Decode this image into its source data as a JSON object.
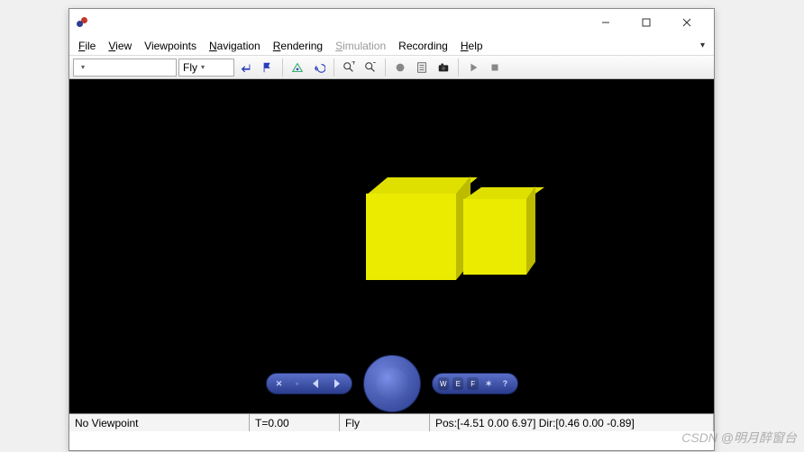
{
  "titlebar": {},
  "menu": {
    "file": "File",
    "view": "View",
    "viewpoints": "Viewpoints",
    "navigation": "Navigation",
    "rendering": "Rendering",
    "simulation": "Simulation",
    "recording": "Recording",
    "help": "Help"
  },
  "toolbar": {
    "nav_mode_options": [
      "Fly"
    ],
    "nav_mode_selected": "Fly"
  },
  "navpad": {
    "btn_w": "W",
    "btn_e": "E",
    "btn_f": "F",
    "btn_q": "?"
  },
  "status": {
    "viewpoint": "No Viewpoint",
    "time": "T=0.00",
    "mode": "Fly",
    "pos": "Pos:[-4.51 0.00 6.97] Dir:[0.46 0.00 -0.89]"
  },
  "watermark": "CSDN @明月醉窗台",
  "chart_data": {
    "type": "table",
    "title": "3D viewport contents",
    "rows": [
      {
        "object": "box-1",
        "color": "#ebeb00",
        "approx_position": "left",
        "relative_size": "large"
      },
      {
        "object": "box-2",
        "color": "#ebeb00",
        "approx_position": "right",
        "relative_size": "small"
      }
    ]
  }
}
